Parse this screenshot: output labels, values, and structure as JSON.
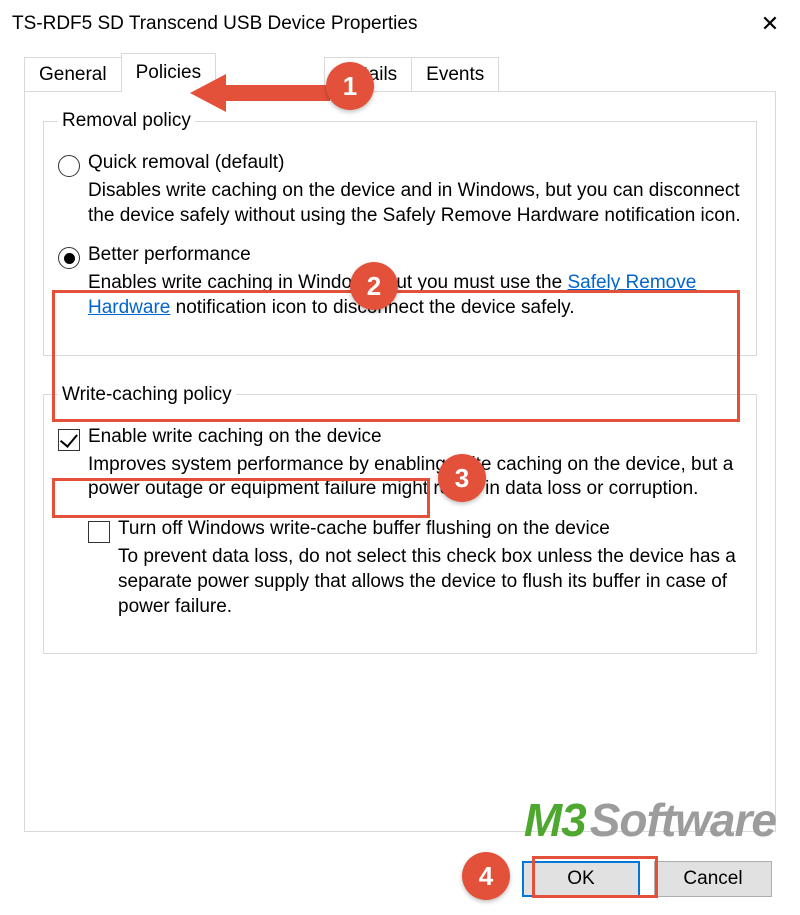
{
  "title": "TS-RDF5 SD  Transcend USB Device Properties",
  "close_glyph": "✕",
  "tabs": {
    "general": "General",
    "policies": "Policies",
    "volumes_hidden": "",
    "details": "Details",
    "events": "Events"
  },
  "removal_policy": {
    "legend": "Removal policy",
    "quick": {
      "label": "Quick removal (default)",
      "desc": "Disables write caching on the device and in Windows, but you can disconnect the device safely without using the Safely Remove Hardware notification icon."
    },
    "better": {
      "label": "Better performance",
      "desc_before": "Enables write caching in Windows, but you must use the ",
      "desc_link": "Safely Remove Hardware",
      "desc_after": " notification icon to disconnect the device safely."
    }
  },
  "write_caching": {
    "legend": "Write-caching policy",
    "enable": {
      "label": "Enable write caching on the device",
      "desc": "Improves system performance by enabling write caching on the device, but a power outage or equipment failure might result in data loss or corruption."
    },
    "turnoff": {
      "label": "Turn off Windows write-cache buffer flushing on the device",
      "desc": "To prevent data loss, do not select this check box unless the device has a separate power supply that allows the device to flush its buffer in case of power failure."
    }
  },
  "buttons": {
    "ok": "OK",
    "cancel": "Cancel"
  },
  "callouts": {
    "c1": "1",
    "c2": "2",
    "c3": "3",
    "c4": "4"
  },
  "watermark": {
    "m3": "M3",
    "soft": " Software"
  }
}
